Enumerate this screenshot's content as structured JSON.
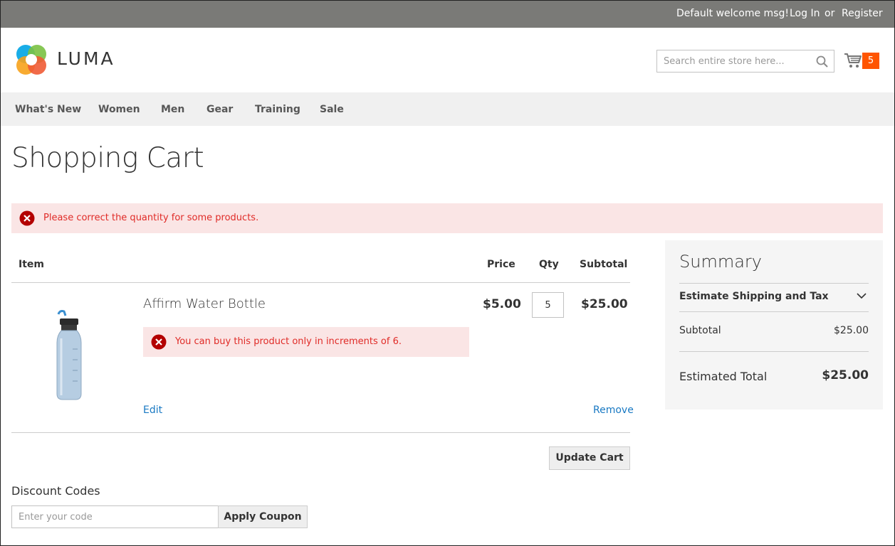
{
  "header": {
    "welcome": "Default welcome msg!",
    "login": "Log In",
    "or": "or",
    "register": "Register",
    "logo_text": "LUMA",
    "search_placeholder": "Search entire store here...",
    "cart_count": "5",
    "icons": {
      "search": "search-icon",
      "cart": "cart-icon",
      "logo": "luma-logo-icon"
    }
  },
  "nav": {
    "items": [
      "What's New",
      "Women",
      "Men",
      "Gear",
      "Training",
      "Sale"
    ]
  },
  "page": {
    "title": "Shopping Cart",
    "global_error": "Please correct the quantity for some products."
  },
  "cart": {
    "headers": {
      "item": "Item",
      "price": "Price",
      "qty": "Qty",
      "subtotal": "Subtotal"
    },
    "item": {
      "name": "Affirm Water Bottle",
      "price": "$5.00",
      "qty": "5",
      "subtotal": "$25.00",
      "error": "You can buy this product only in increments of 6.",
      "edit": "Edit",
      "remove": "Remove"
    },
    "update_button": "Update Cart"
  },
  "discount": {
    "title": "Discount Codes",
    "placeholder": "Enter your code",
    "apply_button": "Apply Coupon"
  },
  "summary": {
    "title": "Summary",
    "estimate_shipping": "Estimate Shipping and Tax",
    "subtotal_label": "Subtotal",
    "subtotal_value": "$25.00",
    "total_label": "Estimated Total",
    "total_value": "$25.00"
  },
  "colors": {
    "topbar": "#7a7a77",
    "link": "#1979c3",
    "error_bg": "#fae5e5",
    "error_text": "#e02b27",
    "cart_badge": "#ff5501"
  }
}
